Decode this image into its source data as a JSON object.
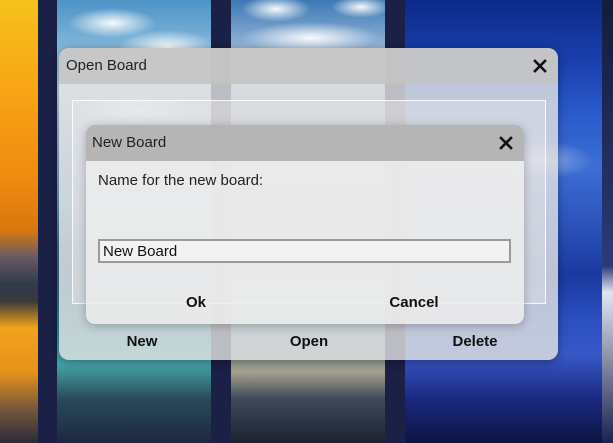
{
  "outer_dialog": {
    "title": "Open Board",
    "close_icon": "close-icon",
    "buttons": {
      "new_label": "New",
      "open_label": "Open",
      "delete_label": "Delete"
    }
  },
  "inner_dialog": {
    "title": "New Board",
    "close_icon": "close-icon",
    "prompt": "Name for the new board:",
    "name_input": {
      "value": "New Board",
      "placeholder": ""
    },
    "buttons": {
      "ok_label": "Ok",
      "cancel_label": "Cancel"
    }
  }
}
